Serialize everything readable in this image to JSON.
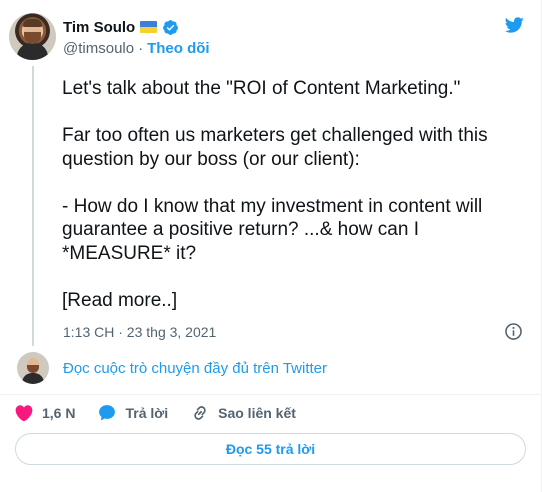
{
  "author": {
    "name": "Tim Soulo",
    "handle": "@timsoulo",
    "separator": "·",
    "follow_label": "Theo dõi"
  },
  "tweet": {
    "lines": [
      "Let's talk about the \"ROI of Content Marketing.\"",
      "Far too often us marketers get challenged with this question by our boss (or our client):",
      "- How do I know that my investment in content will guarantee a positive return? ...& how can I *MEASURE* it?",
      "[Read more..]"
    ],
    "timestamp": "1:13 CH · 23 thg 3, 2021"
  },
  "thread": {
    "link_label": "Đọc cuộc trò chuyện đầy đủ trên Twitter"
  },
  "actions": {
    "like_count": "1,6 N",
    "reply_label": "Trả lời",
    "copy_link_label": "Sao liên kết"
  },
  "read_replies_label": "Đọc 55 trả lời",
  "icons": {
    "brand": "twitter-bird-icon",
    "verified": "verified-badge-icon",
    "flag": "ukraine-flag-icon",
    "info": "info-icon",
    "like": "heart-icon",
    "reply": "reply-bubble-icon",
    "link": "link-icon"
  },
  "colors": {
    "accent": "#1d9bf0",
    "like": "#f91880",
    "muted": "#536471",
    "text": "#0f1419"
  }
}
